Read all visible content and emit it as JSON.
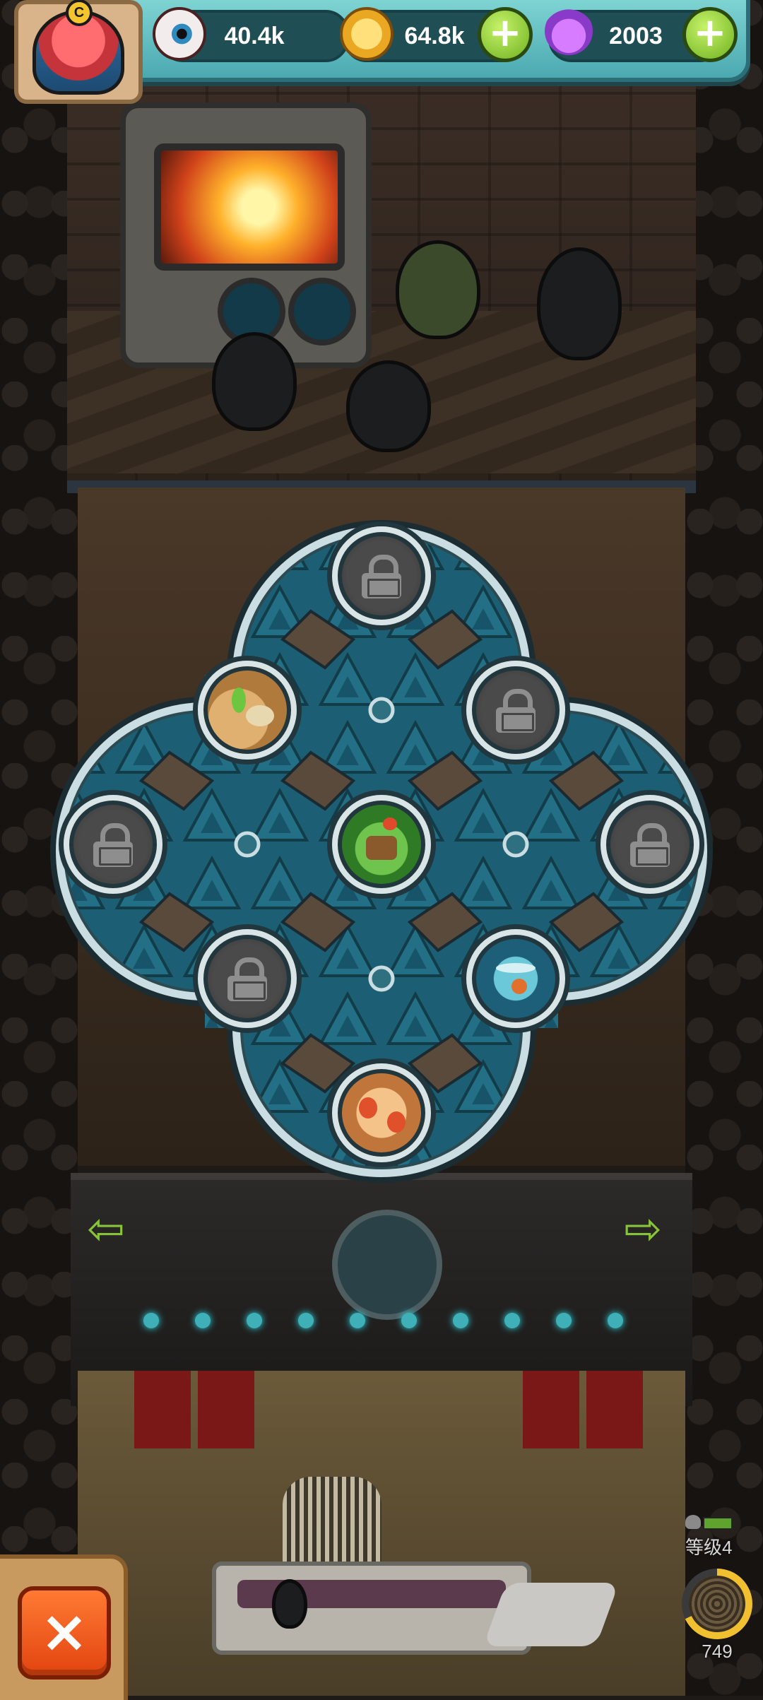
{
  "hud": {
    "eyes_value": "40.4k",
    "coins_value": "64.8k",
    "potions_value": "2003",
    "plus_label": "+"
  },
  "map": {
    "nodes": [
      {
        "id": "top",
        "state": "locked"
      },
      {
        "id": "upper-left",
        "state": "unlocked",
        "biome": "desert"
      },
      {
        "id": "upper-right",
        "state": "locked"
      },
      {
        "id": "left",
        "state": "locked"
      },
      {
        "id": "center",
        "state": "unlocked",
        "biome": "forest"
      },
      {
        "id": "right",
        "state": "locked"
      },
      {
        "id": "lower-left",
        "state": "locked"
      },
      {
        "id": "lower-right",
        "state": "unlocked",
        "biome": "water"
      },
      {
        "id": "bottom",
        "state": "unlocked",
        "biome": "lava"
      }
    ]
  },
  "navigation": {
    "left_arrow": "⇦",
    "right_arrow": "⇨"
  },
  "level": {
    "label": "等级4",
    "points": "749",
    "progress": 0.68
  },
  "close_label": "×",
  "colors": {
    "hud_bg": "#7fd3d3",
    "board_tile": "#1f6e83",
    "board_frame": "#c9dde2",
    "close_button": "#ff6a24",
    "plus_button": "#8fd32a"
  }
}
